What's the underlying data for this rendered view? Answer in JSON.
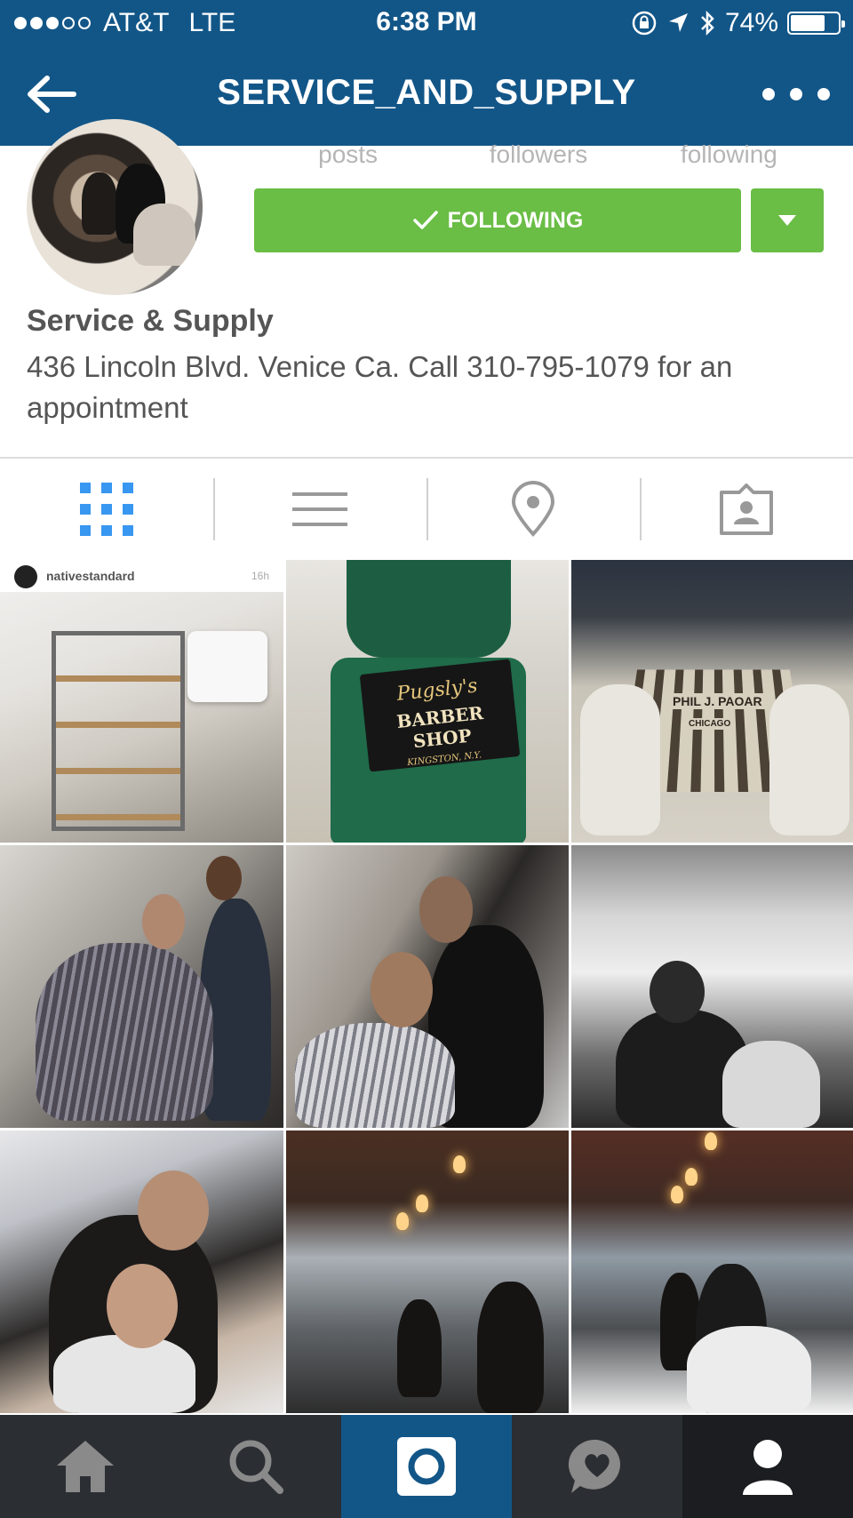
{
  "status_bar": {
    "carrier": "AT&T",
    "network": "LTE",
    "time": "6:38 PM",
    "battery_percent": "74%",
    "battery_level": 0.74,
    "signal_bars_filled": 3,
    "signal_bars_total": 5
  },
  "nav": {
    "title": "SERVICE_AND_SUPPLY",
    "back_icon": "arrow-left-icon",
    "more_icon": "more-horizontal-icon"
  },
  "profile": {
    "stats_labels": [
      "posts",
      "followers",
      "following"
    ],
    "follow_button_label": "FOLLOWING",
    "name": "Service & Supply",
    "bio": "436 Lincoln Blvd. Venice Ca. Call 310-795-1079 for an appointment"
  },
  "tabs": [
    {
      "name": "grid",
      "icon": "grid-icon",
      "active": true
    },
    {
      "name": "list",
      "icon": "list-icon",
      "active": false
    },
    {
      "name": "location",
      "icon": "location-pin-icon",
      "active": false
    },
    {
      "name": "tagged",
      "icon": "tagged-person-icon",
      "active": false
    }
  ],
  "photos": {
    "post1_username": "nativestandard",
    "post1_age": "16h",
    "post2_sign_line1": "Pugsly's",
    "post2_sign_line2": "BARBER SHOP",
    "post2_sign_line3": "KINGSTON, N.Y.",
    "post3_grate_text": "PHIL J. PAOAR",
    "post3_grate_city": "CHICAGO"
  },
  "bottom_nav": [
    {
      "name": "home",
      "icon": "home-icon"
    },
    {
      "name": "search",
      "icon": "search-icon"
    },
    {
      "name": "camera",
      "icon": "camera-icon",
      "active": true
    },
    {
      "name": "activity",
      "icon": "heart-bubble-icon"
    },
    {
      "name": "profile",
      "icon": "person-icon"
    }
  ],
  "colors": {
    "header_blue": "#125688",
    "follow_green": "#6abd45",
    "active_tab_blue": "#3897f0",
    "bottom_bar": "#2b2e32"
  }
}
